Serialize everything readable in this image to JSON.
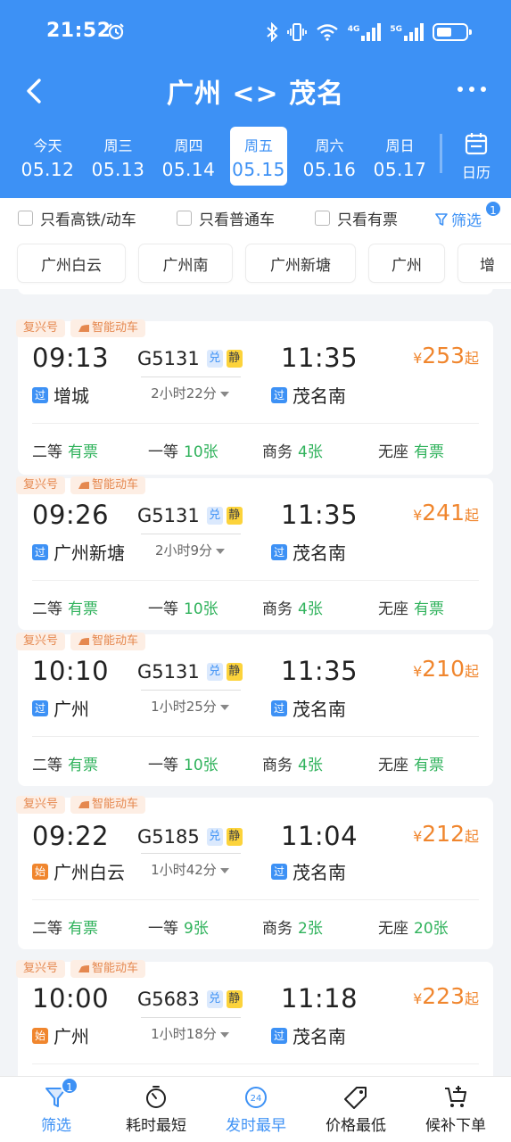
{
  "status_bar": {
    "time": "21:52",
    "network_4g": "4G",
    "network_5g": "5G"
  },
  "nav": {
    "title": "广州 <> 茂名"
  },
  "dates": [
    {
      "weekday": "今天",
      "date": "05.12"
    },
    {
      "weekday": "周三",
      "date": "05.13"
    },
    {
      "weekday": "周四",
      "date": "05.14"
    },
    {
      "weekday": "周五",
      "date": "05.15",
      "active": true
    },
    {
      "weekday": "周六",
      "date": "05.16"
    },
    {
      "weekday": "周日",
      "date": "05.17"
    }
  ],
  "calendar_label": "日历",
  "filters": {
    "high_speed": "只看高铁/动车",
    "regular": "只看普通车",
    "available": "只看有票",
    "filter_label": "筛选",
    "filter_count": "1"
  },
  "stations": [
    "广州白云",
    "广州南",
    "广州新塘",
    "广州",
    "增"
  ],
  "tags": {
    "fuxing": "复兴号",
    "smart": "智能动车"
  },
  "badges": {
    "dui": "兑",
    "jing": "静"
  },
  "seat_labels": {
    "second": "二等",
    "first": "一等",
    "business": "商务",
    "none": "无座"
  },
  "price_symbols": {
    "yen": "¥",
    "qi": "起"
  },
  "trains": [
    {
      "dep": "09:13",
      "no": "G5131",
      "arr": "11:35",
      "price": "253",
      "from_type": "过",
      "from": "增城",
      "duration": "2小时22分",
      "to_type": "过",
      "to": "茂名南",
      "second": "有票",
      "first": "10张",
      "business": "4张",
      "none": "有票"
    },
    {
      "dep": "09:26",
      "no": "G5131",
      "arr": "11:35",
      "price": "241",
      "from_type": "过",
      "from": "广州新塘",
      "duration": "2小时9分",
      "to_type": "过",
      "to": "茂名南",
      "second": "有票",
      "first": "10张",
      "business": "4张",
      "none": "有票"
    },
    {
      "dep": "10:10",
      "no": "G5131",
      "arr": "11:35",
      "price": "210",
      "from_type": "过",
      "from": "广州",
      "duration": "1小时25分",
      "to_type": "过",
      "to": "茂名南",
      "second": "有票",
      "first": "10张",
      "business": "4张",
      "none": "有票"
    },
    {
      "dep": "09:22",
      "no": "G5185",
      "arr": "11:04",
      "price": "212",
      "from_type": "始",
      "from": "广州白云",
      "duration": "1小时42分",
      "to_type": "过",
      "to": "茂名南",
      "second": "有票",
      "first": "9张",
      "business": "2张",
      "none": "20张"
    },
    {
      "dep": "10:00",
      "no": "G5683",
      "arr": "11:18",
      "price": "223",
      "from_type": "始",
      "from": "广州",
      "duration": "1小时18分",
      "to_type": "过",
      "to": "茂名南",
      "second": "",
      "first": "",
      "business": "",
      "none": ""
    }
  ],
  "bottom_bar": {
    "filter": "筛选",
    "filter_count": "1",
    "shortest": "耗时最短",
    "earliest": "发时最早",
    "earliest_icon_text": "24",
    "cheapest": "价格最低",
    "waitlist": "候补下单"
  },
  "colors": {
    "primary": "#3d91f5",
    "price": "#f0862e",
    "available": "#2fb25b"
  }
}
